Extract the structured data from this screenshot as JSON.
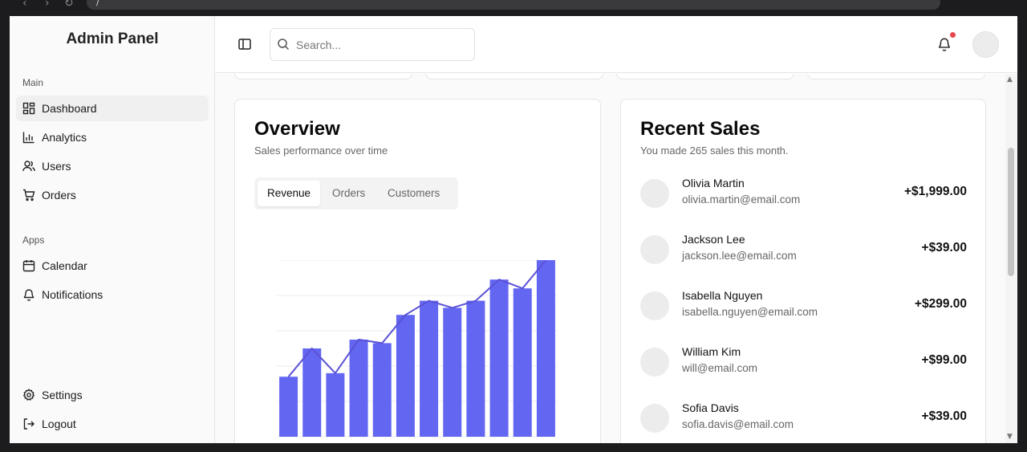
{
  "browser": {
    "back": "‹",
    "forward": "›",
    "reload": "↻",
    "url": "/"
  },
  "sidebar": {
    "title": "Admin Panel",
    "groups": [
      {
        "label": "Main",
        "items": [
          {
            "label": "Dashboard",
            "icon": "dashboard-icon",
            "active": true
          },
          {
            "label": "Analytics",
            "icon": "bar-chart-icon"
          },
          {
            "label": "Users",
            "icon": "users-icon"
          },
          {
            "label": "Orders",
            "icon": "shopping-cart-icon"
          }
        ]
      },
      {
        "label": "Apps",
        "items": [
          {
            "label": "Calendar",
            "icon": "calendar-icon"
          },
          {
            "label": "Notifications",
            "icon": "bell-icon"
          }
        ]
      }
    ],
    "footer": [
      {
        "label": "Settings",
        "icon": "gear-icon"
      },
      {
        "label": "Logout",
        "icon": "logout-icon"
      }
    ]
  },
  "header": {
    "search_placeholder": "Search...",
    "notification_dot_color": "#e5484d"
  },
  "overview": {
    "title": "Overview",
    "subtitle": "Sales performance over time",
    "tabs": [
      "Revenue",
      "Orders",
      "Customers"
    ],
    "active_tab": "Revenue"
  },
  "recent_sales": {
    "title": "Recent Sales",
    "subtitle": "You made 265 sales this month.",
    "items": [
      {
        "name": "Olivia Martin",
        "email": "olivia.martin@email.com",
        "amount": "+$1,999.00"
      },
      {
        "name": "Jackson Lee",
        "email": "jackson.lee@email.com",
        "amount": "+$39.00"
      },
      {
        "name": "Isabella Nguyen",
        "email": "isabella.nguyen@email.com",
        "amount": "+$299.00"
      },
      {
        "name": "William Kim",
        "email": "will@email.com",
        "amount": "+$99.00"
      },
      {
        "name": "Sofia Davis",
        "email": "sofia.davis@email.com",
        "amount": "+$39.00"
      }
    ]
  },
  "chart_data": {
    "type": "bar",
    "title": "",
    "xlabel": "",
    "ylabel": "",
    "categories": [],
    "values": [
      3.4,
      5.0,
      3.6,
      5.5,
      5.3,
      6.9,
      7.7,
      7.3,
      7.7,
      8.9,
      8.4,
      10.0
    ],
    "line_values": [
      3.4,
      5.0,
      3.6,
      5.5,
      5.3,
      6.9,
      7.7,
      7.3,
      7.7,
      8.9,
      8.4,
      10.0
    ],
    "ylim": [
      0,
      10
    ],
    "grid": true,
    "bar_color": "#6366f1",
    "line_color": "#5b52d6"
  }
}
